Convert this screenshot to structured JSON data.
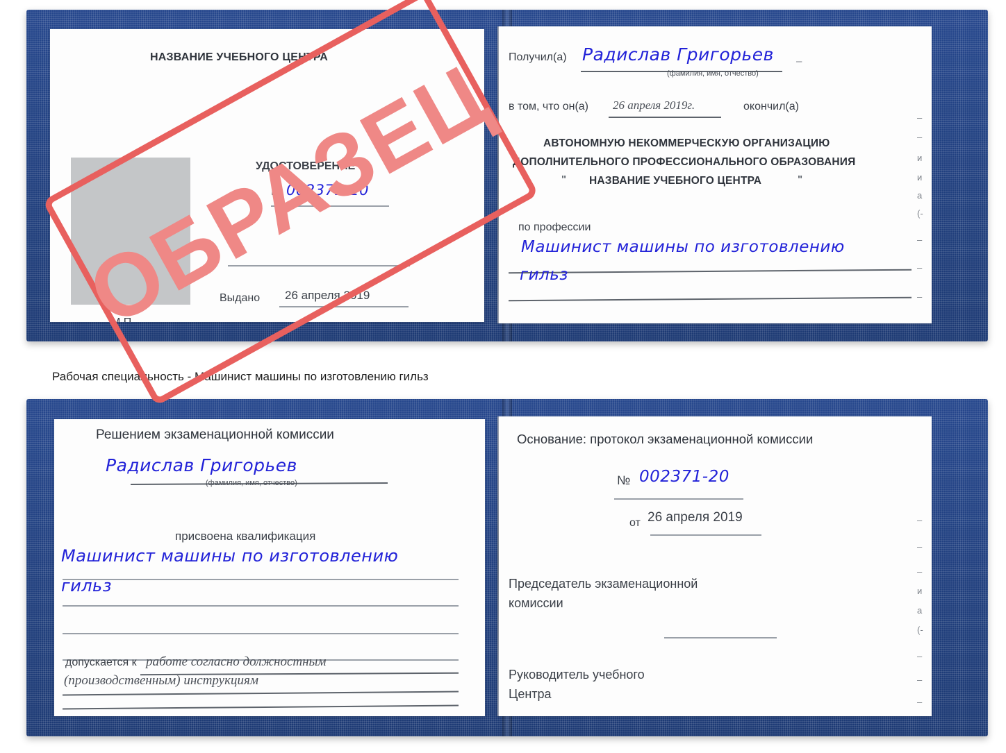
{
  "document": {
    "kind": "Russian vocational training certificate (удостоверение) — open booklet, two spreads",
    "caption": "Рабочая специальность - Машинист машины по изготовлению гильз",
    "stamp_label": "ОБРАЗЕЦ",
    "colors": {
      "cover_blue": "#21407f",
      "stamp_red": "#e8605e",
      "stamp_fill": "#ef8886",
      "handwriting_blue": "#2222d8",
      "rule_gray": "#9aa0a8",
      "photo_gray": "#c4c6c8"
    }
  },
  "spread_top": {
    "left_page": {
      "heading": "НАЗВАНИЕ УЧЕБНОГО ЦЕНТРА",
      "title": "УДОСТОВЕРЕНИЕ",
      "number_label": "№",
      "number_value": "002371-20",
      "issued_label": "Выдано",
      "issued_value": "26 апреля 2019",
      "seal_label": "М.П.",
      "photo_placeholder": "photo-box"
    },
    "right_page": {
      "received_label": "Получил(а)",
      "received_value": "Радислав Григорьев",
      "received_hint": "(фамилия, имя, отчество)",
      "in_that_label": "в том, что он(а)",
      "date_value": "26 апреля 2019г.",
      "finished_label": "окончил(а)",
      "org_line1": "АВТОНОМНУЮ НЕКОММЕРЧЕСКУЮ ОРГАНИЗАЦИЮ",
      "org_line2": "ДОПОЛНИТЕЛЬНОГО ПРОФЕССИОНАЛЬНОГО ОБРАЗОВАНИЯ",
      "org_quote_open": "\"",
      "org_line3": "НАЗВАНИЕ УЧЕБНОГО ЦЕНТРА",
      "org_quote_close": "\"",
      "profession_label": "по профессии",
      "profession_value_line1": "Машинист машины по изготовлению",
      "profession_value_line2": "гильз",
      "edge_marks": [
        "–",
        "–",
        "и",
        "а",
        "(-",
        "–",
        "–",
        "–"
      ]
    }
  },
  "spread_bottom": {
    "left_page": {
      "heading": "Решением экзаменационной комиссии",
      "name_value": "Радислав Григорьев",
      "name_hint": "(фамилия, имя, отчество)",
      "qualification_label": "присвоена квалификация",
      "qualification_value_line1": "Машинист машины по изготовлению",
      "qualification_value_line2": "гильз",
      "admitted_label": "допускается к",
      "admitted_value_line1": "работе согласно должностным",
      "admitted_value_line2": "(производственным) инструкциям"
    },
    "right_page": {
      "basis_label": "Основание: протокол экзаменационной комиссии",
      "number_label": "№",
      "number_value": "002371-20",
      "date_label": "от",
      "date_value": "26 апреля 2019",
      "chairman_line1": "Председатель экзаменационной",
      "chairman_line2": "комиссии",
      "head_line1": "Руководитель учебного",
      "head_line2": "Центра",
      "edge_marks": [
        "–",
        "–",
        "–",
        "и",
        "а",
        "(-",
        "–",
        "–",
        "–",
        "–"
      ]
    }
  }
}
